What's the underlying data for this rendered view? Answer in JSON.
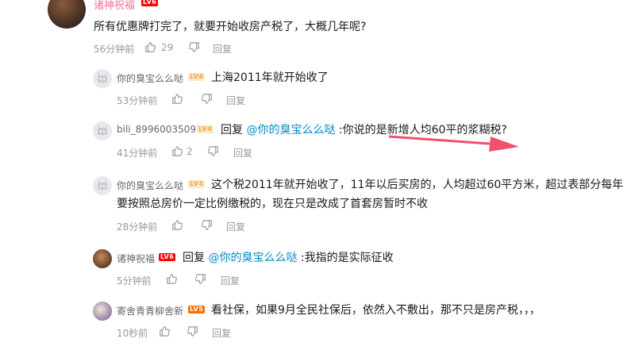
{
  "top_comment": {
    "username": "诸神祝福",
    "text": "所有优惠牌打完了，就要开始收房产税了，大概几年呢?",
    "time": "56分钟前",
    "likes": "29",
    "reply_label": "回复"
  },
  "replies": [
    {
      "username": "你的臭宝么么哒",
      "level": "LV4",
      "text": "上海2011年就开始收了",
      "time": "53分钟前",
      "likes": "",
      "reply_label": "回复"
    },
    {
      "username": "bili_89960035097",
      "level": "LV4",
      "reply_prefix": "回复 ",
      "mention": "@你的臭宝么么哒",
      "text": " :你说的是新增人均60平的浆糊税?",
      "time": "41分钟前",
      "likes": "2",
      "reply_label": "回复"
    },
    {
      "username": "你的臭宝么么哒",
      "level": "LV4",
      "text_line1": "这个税2011年就开始收了，11年以后买房的，人均超过60平方米，超过表部分每年",
      "text_line2": "要按照总房价一定比例缴税的，现在只是改成了首套房暂时不收",
      "time": "28分钟前",
      "likes": "",
      "reply_label": "回复"
    },
    {
      "username": "诸神祝福",
      "level": "LV6",
      "reply_prefix": "回复 ",
      "mention": "@你的臭宝么么哒",
      "text": " :我指的是实际征收",
      "time": "5分钟前",
      "likes": "",
      "reply_label": "回复"
    },
    {
      "username": "寄舍青青柳舍新",
      "level": "LV5",
      "text": "看社保，如果9月全民社保后，依然入不敷出，那不只是房产税，，，",
      "time": "10秒前",
      "likes": "",
      "reply_label": "回复"
    }
  ],
  "icons": {
    "like": "thumbs-up-icon",
    "dislike": "thumbs-down-icon",
    "annotation": "red-arrow"
  },
  "colors": {
    "mention": "#008ac5",
    "meta": "#9499a0",
    "arrow": "#f0506e"
  }
}
